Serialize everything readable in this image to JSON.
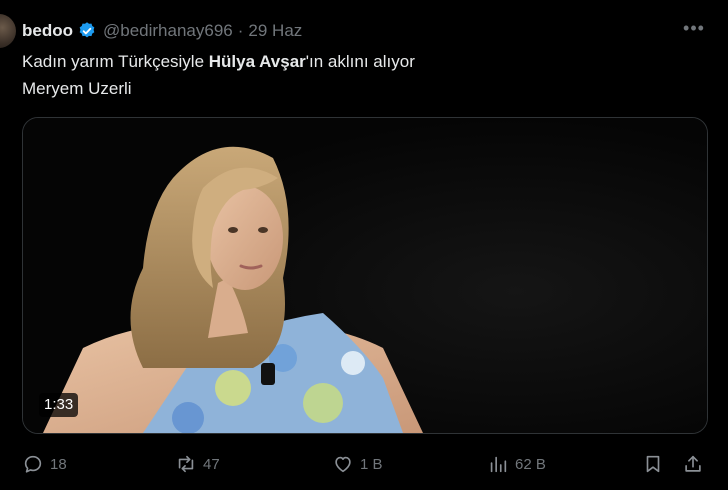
{
  "author": {
    "display_name": "bedoo",
    "handle": "@bedirhanay696",
    "separator": "·",
    "date": "29 Haz",
    "more_label": "•••"
  },
  "tweet": {
    "text_part1": "Kadın yarım Türkçesiyle ",
    "text_bold": "Hülya Avşar",
    "text_part2": "'ın aklını alıyor",
    "text_line2": "Meryem Uzerli"
  },
  "media": {
    "type": "video",
    "duration": "1:33"
  },
  "actions": {
    "replies": "18",
    "reposts": "47",
    "likes": "1 B",
    "views": "62 B"
  },
  "colors": {
    "background": "#000000",
    "text": "#e7e9ea",
    "muted": "#71767b",
    "verified": "#1d9bf0"
  },
  "icons": [
    "more-icon",
    "verified-badge-icon",
    "reply-icon",
    "repost-icon",
    "like-icon",
    "views-icon",
    "bookmark-icon",
    "share-icon"
  ]
}
